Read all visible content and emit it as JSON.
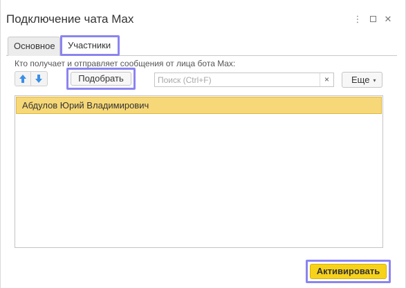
{
  "window": {
    "title": "Подключение чата Max",
    "controls": {
      "more_icon": "more-vertical-icon",
      "more_glyph": "⋮",
      "maximize_icon": "maximize-icon",
      "close_icon": "close-icon",
      "close_glyph": "✕"
    }
  },
  "tabs": [
    {
      "label": "Основное",
      "active": false
    },
    {
      "label": "Участники",
      "active": true
    }
  ],
  "members": {
    "hint": "Кто получает и отправляет сообщения от лица бота Max:",
    "toolbar": {
      "move_up_icon": "arrow-up-icon",
      "move_down_icon": "arrow-down-icon",
      "pick_label": "Подобрать",
      "more_label": "Еще",
      "more_caret": "▾"
    },
    "search": {
      "placeholder": "Поиск (Ctrl+F)",
      "value": "",
      "clear_glyph": "×"
    },
    "list": [
      {
        "name": "Абдулов Юрий Владимирович",
        "selected": true
      }
    ]
  },
  "footer": {
    "activate_label": "Активировать"
  },
  "colors": {
    "highlight_outline": "#8b84f0",
    "selected_row": "#f7d878",
    "primary_button": "#f7d21b",
    "arrow_icon": "#3a8ee6"
  }
}
